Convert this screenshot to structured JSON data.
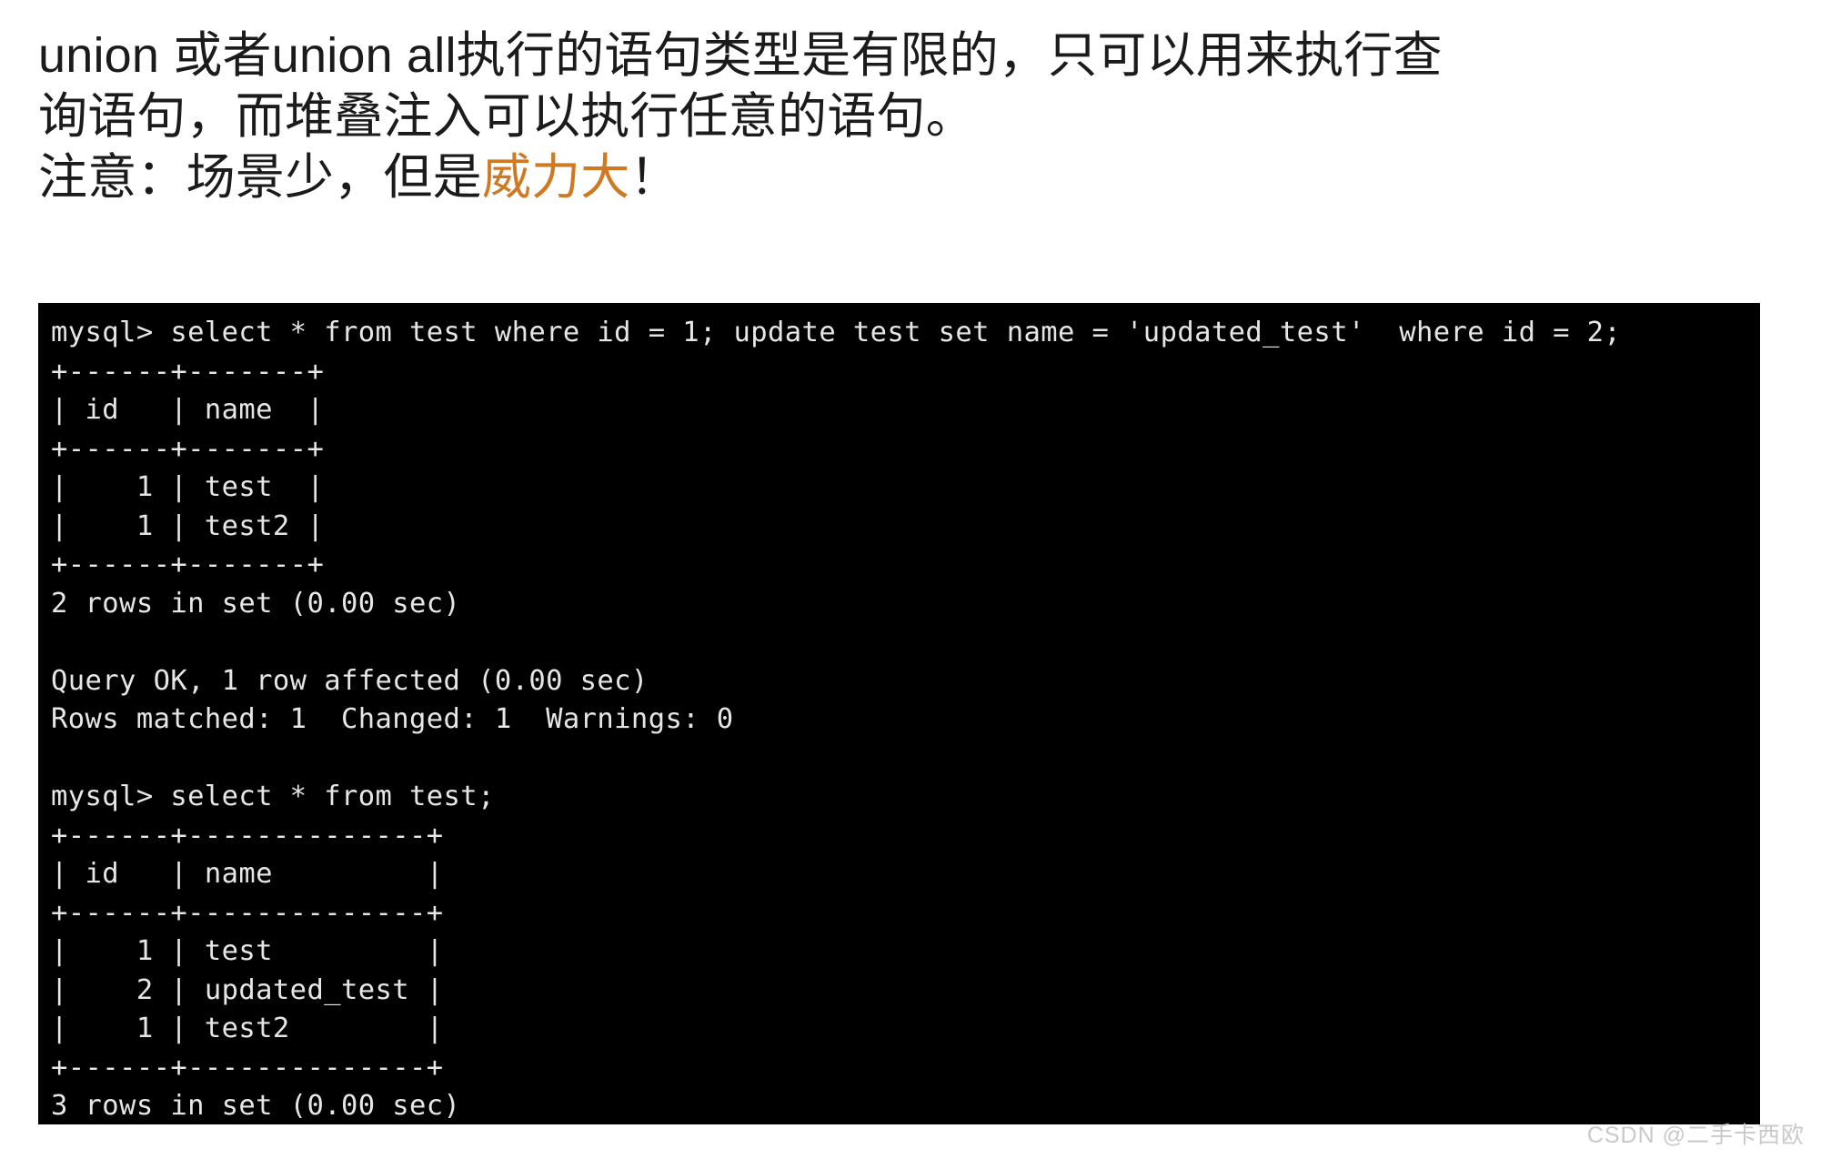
{
  "prose": {
    "lines": [
      {
        "segments": [
          {
            "text": "union 或者union all执行的语句类型是有限的，只可以用来执行查",
            "highlight": false
          }
        ]
      },
      {
        "segments": [
          {
            "text": "询语句，而堆叠注入可以执行任意的语句。",
            "highlight": false
          }
        ]
      },
      {
        "segments": [
          {
            "text": "注意：场景少，但是",
            "highlight": false
          },
          {
            "text": "威力大",
            "highlight": true
          },
          {
            "text": "！",
            "highlight": false
          }
        ]
      }
    ],
    "highlight_color": "#cf7a22",
    "text_color": "#1b1b1b"
  },
  "terminal": {
    "background_color": "#000000",
    "foreground_color": "#e6e6e6",
    "lines": [
      "mysql> select * from test where id = 1; update test set name = 'updated_test'  where id = 2;",
      "+------+-------+",
      "| id   | name  |",
      "+------+-------+",
      "|    1 | test  |",
      "|    1 | test2 |",
      "+------+-------+",
      "2 rows in set (0.00 sec)",
      "",
      "Query OK, 1 row affected (0.00 sec)",
      "Rows matched: 1  Changed: 1  Warnings: 0",
      "",
      "mysql> select * from test;",
      "+------+--------------+",
      "| id   | name         |",
      "+------+--------------+",
      "|    1 | test         |",
      "|    2 | updated_test |",
      "|    1 | test2        |",
      "+------+--------------+",
      "3 rows in set (0.00 sec)"
    ],
    "prompt": "mysql>",
    "queries": [
      "select * from test where id = 1; update test set name = 'updated_test'  where id = 2;",
      "select * from test;"
    ],
    "result_tables": [
      {
        "columns": [
          "id",
          "name"
        ],
        "rows": [
          [
            "1",
            "test"
          ],
          [
            "1",
            "test2"
          ]
        ],
        "footer": "2 rows in set (0.00 sec)"
      },
      {
        "columns": [
          "id",
          "name"
        ],
        "rows": [
          [
            "1",
            "test"
          ],
          [
            "2",
            "updated_test"
          ],
          [
            "1",
            "test2"
          ]
        ],
        "footer": "3 rows in set (0.00 sec)"
      }
    ],
    "status_messages": [
      "Query OK, 1 row affected (0.00 sec)",
      "Rows matched: 1  Changed: 1  Warnings: 0"
    ]
  },
  "watermark": {
    "text": "CSDN @二手卡西欧"
  }
}
